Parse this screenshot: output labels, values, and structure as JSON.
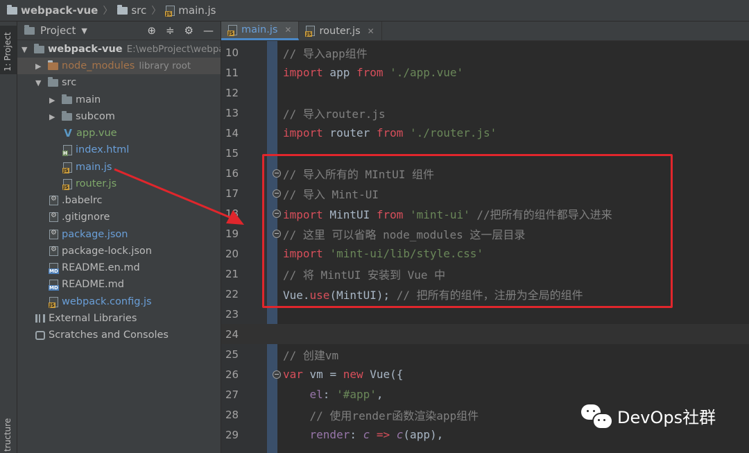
{
  "breadcrumb": {
    "project": "webpack-vue",
    "folder": "src",
    "file": "main.js"
  },
  "toolstrip": {
    "project_tab": "1: Project",
    "structure_tab": "tructure"
  },
  "project_panel": {
    "title": "Project",
    "header_icons": [
      "target-icon",
      "collapse-icon",
      "gear-icon",
      "minimize-icon"
    ],
    "tree": [
      {
        "label": "webpack-vue",
        "sub": "E:\\webProject\\webpa",
        "type": "root"
      },
      {
        "label": "node_modules",
        "sub": "library root",
        "type": "folder-excluded"
      },
      {
        "label": "src",
        "type": "folder-open"
      },
      {
        "label": "main",
        "type": "folder"
      },
      {
        "label": "subcom",
        "type": "folder"
      },
      {
        "label": "app.vue",
        "type": "vue"
      },
      {
        "label": "index.html",
        "type": "html"
      },
      {
        "label": "main.js",
        "type": "js"
      },
      {
        "label": "router.js",
        "type": "js"
      },
      {
        "label": ".babelrc",
        "type": "config"
      },
      {
        "label": ".gitignore",
        "type": "config"
      },
      {
        "label": "package.json",
        "type": "json"
      },
      {
        "label": "package-lock.json",
        "type": "json"
      },
      {
        "label": "README.en.md",
        "type": "md"
      },
      {
        "label": "README.md",
        "type": "md"
      },
      {
        "label": "webpack.config.js",
        "type": "js"
      },
      {
        "label": "External Libraries",
        "type": "lib"
      },
      {
        "label": "Scratches and Consoles",
        "type": "scratch"
      }
    ]
  },
  "tabs": [
    {
      "label": "main.js",
      "active": true
    },
    {
      "label": "router.js",
      "active": false
    }
  ],
  "code_lines": [
    {
      "num": "10",
      "text": "// 导入app组件"
    },
    {
      "num": "11",
      "text": "import app from './app.vue'"
    },
    {
      "num": "12",
      "text": ""
    },
    {
      "num": "13",
      "text": "// 导入router.js"
    },
    {
      "num": "14",
      "text": "import router from './router.js'"
    },
    {
      "num": "15",
      "text": ""
    },
    {
      "num": "16",
      "text": "// 导入所有的 MIntUI 组件"
    },
    {
      "num": "17",
      "text": "// 导入 Mint-UI"
    },
    {
      "num": "18",
      "text": "import MintUI from 'mint-ui' //把所有的组件都导入进来"
    },
    {
      "num": "19",
      "text": "// 这里 可以省略 node_modules 这一层目录"
    },
    {
      "num": "20",
      "text": "import 'mint-ui/lib/style.css'"
    },
    {
      "num": "21",
      "text": "// 将 MintUI 安装到 Vue 中"
    },
    {
      "num": "22",
      "text": "Vue.use(MintUI); // 把所有的组件，注册为全局的组件"
    },
    {
      "num": "23",
      "text": ""
    },
    {
      "num": "24",
      "text": ""
    },
    {
      "num": "25",
      "text": "// 创建vm"
    },
    {
      "num": "26",
      "text": "var vm = new Vue({"
    },
    {
      "num": "27",
      "text": "    el: '#app',"
    },
    {
      "num": "28",
      "text": "    // 使用render函数渲染app组件"
    },
    {
      "num": "29",
      "text": "    render: c => c(app),"
    }
  ],
  "watermark": "DevOps社群",
  "colors": {
    "highlight_box": "#e0262c",
    "arrow": "#e0262c",
    "active_tab_accent": "#4a88c7"
  }
}
